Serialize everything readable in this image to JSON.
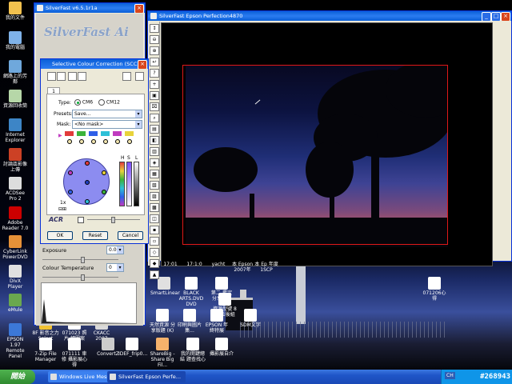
{
  "desktop": {
    "left_icons": [
      {
        "label": "我的文件",
        "color": "#f2c14e"
      },
      {
        "label": "我的電腦",
        "color": "#7fb2e8"
      },
      {
        "label": "網路上的芳鄰",
        "color": "#6fa8dc"
      },
      {
        "label": "資源回收筒",
        "color": "#b6d7a8"
      },
      {
        "label": "Internet Explorer",
        "color": "#3d85c6"
      },
      {
        "label": "討論區影像上傳",
        "color": "#cc4125"
      },
      {
        "label": "ACDSee Pro 2",
        "color": "#dddddd"
      },
      {
        "label": "Adobe Reader 7.0",
        "color": "#cc0000"
      },
      {
        "label": "CyberLink PowerDVD",
        "color": "#e69138"
      },
      {
        "label": "DivX Player",
        "color": "#e0e0e0"
      },
      {
        "label": "eMule",
        "color": "#6aa84f"
      },
      {
        "label": "EPSON 1.97 Remote Panel",
        "color": "#3c78d8"
      }
    ],
    "bottom_icons": [
      {
        "label": "8F 影音之力 Select",
        "color": "#f1c232"
      },
      {
        "label": "071023 照片 轉圖案",
        "color": "#ffffff"
      },
      {
        "label": "CKACC 2007",
        "color": "#d9d9d9"
      },
      {
        "label": "7-Zip File Manager",
        "color": "#ffffff"
      },
      {
        "label": "071111 車修 攝影展心得",
        "color": "#ffffff"
      },
      {
        "label": "ConvertZ",
        "color": "#cccccc"
      },
      {
        "label": "IDEF_frip0...",
        "color": "#ffffff"
      },
      {
        "label": "ShareBig - Share Big Fil...",
        "color": "#f6b26b"
      },
      {
        "label": "我的開鍵總結 題查找心",
        "color": "#ffffff"
      },
      {
        "label": "攝影展自介",
        "color": "#ffffff"
      }
    ],
    "middle_icons": [
      {
        "label": "SmartLinear",
        "color": "#e0e0e0"
      },
      {
        "label": "BLACK ARTS.DVD DVD",
        "color": "#ffffff"
      },
      {
        "label": "第二-鑑定 分享心得",
        "color": "#ffffff"
      },
      {
        "label": "天然資源 分享版題 (K)",
        "color": "#ffffff"
      },
      {
        "label": "印刷與圖片集...",
        "color": "#ffffff"
      },
      {
        "label": "EPSON 年終特展",
        "color": "#ffffff"
      },
      {
        "label": "資源型號 8月11後組",
        "color": "#ffffff"
      },
      {
        "label": "SDM文字",
        "color": "#ffffff"
      },
      {
        "label": "071206心得",
        "color": "#ffffff"
      }
    ],
    "header_labels": [
      "17:01",
      "17:1:0",
      "yacht",
      "本 Epson 2007年",
      "本 Ep 年度 1SCP"
    ]
  },
  "taskbar": {
    "start_label": "開始",
    "buttons": [
      {
        "label": "Windows Live Messen..."
      },
      {
        "label": "SilverFast Epson Perfe..."
      }
    ],
    "lang": "CH",
    "watermark": "#268943"
  },
  "preview_window": {
    "title": "SilverFast Epson Perfection4870",
    "tools": [
      "↕",
      "⊖",
      "⊕",
      "↩",
      "?",
      "+",
      "▣",
      "⌧",
      "⌕",
      "▤",
      "◧",
      "▥",
      "◈",
      "▦",
      "▧",
      "▨",
      "▩",
      "◫",
      "▪",
      "▫",
      "◇",
      "◆",
      "▲"
    ]
  },
  "sf_main": {
    "title": "SilverFast v6.5.1r1a",
    "logo": "SilverFast Ai",
    "exposure_label": "Exposure",
    "exposure_value": "0.00",
    "exposure_level": 0.5,
    "temp_label": "Colour Temperature",
    "temp_value": "0",
    "temp_level": 0.5
  },
  "scc": {
    "title": "Selective Colour Correction (SCC)",
    "tab": "1",
    "type_label": "Type:",
    "type_opt1": "CM6",
    "type_opt2": "CM12",
    "presets_label": "Presets:",
    "presets_value": "Save...",
    "mask_label": "Mask:",
    "mask_value": "<No mask>",
    "hsl": [
      "H",
      "S",
      "L"
    ],
    "zoom_label": "1x",
    "acr_label": "ACR",
    "acr_level": 0.45,
    "ok": "OK",
    "reset": "Reset",
    "cancel": "Cancel",
    "swatches": [
      "#e23b3b",
      "#3bb43b",
      "#2f5fe8",
      "#2ec0d8",
      "#c03bc0",
      "#e8d33b"
    ],
    "wheel_dots": [
      "#e23b3b",
      "#e8d33b",
      "#3bb43b",
      "#2ec0d8",
      "#2f5fe8",
      "#c03bc0"
    ]
  }
}
